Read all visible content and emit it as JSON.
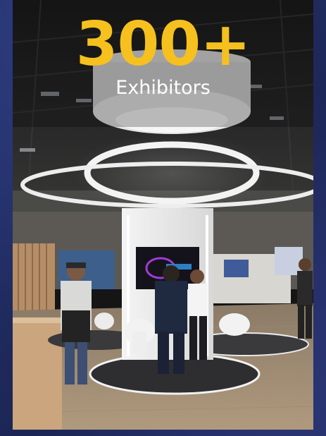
{
  "stat": {
    "number": "300+",
    "label": "Exhibitors",
    "number_color": "#f6c11e",
    "label_color": "#ffffff"
  },
  "photo": {
    "subject": "exhibition-booth"
  }
}
